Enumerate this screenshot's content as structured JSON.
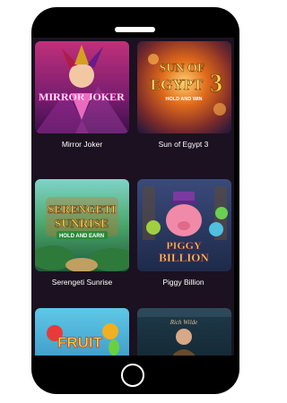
{
  "games": [
    {
      "name": "Mirror Joker",
      "art_title": "MIRROR JOKER"
    },
    {
      "name": "Sun of Egypt 3",
      "art_title_line1": "SUN OF",
      "art_title_line2": "EGYPT",
      "art_number": "3",
      "art_subtitle": "HOLD AND WIN"
    },
    {
      "name": "Serengeti Sunrise",
      "art_title_line1": "SERENGETI",
      "art_title_line2": "SUNRISE",
      "art_subtitle": "HOLD AND EARN"
    },
    {
      "name": "Piggy Billion",
      "art_title_line1": "PIGGY",
      "art_title_line2": "BILLION"
    },
    {
      "name": "",
      "art_title": "FRUIT"
    },
    {
      "name": "",
      "art_title": "Rich Wilde"
    }
  ]
}
